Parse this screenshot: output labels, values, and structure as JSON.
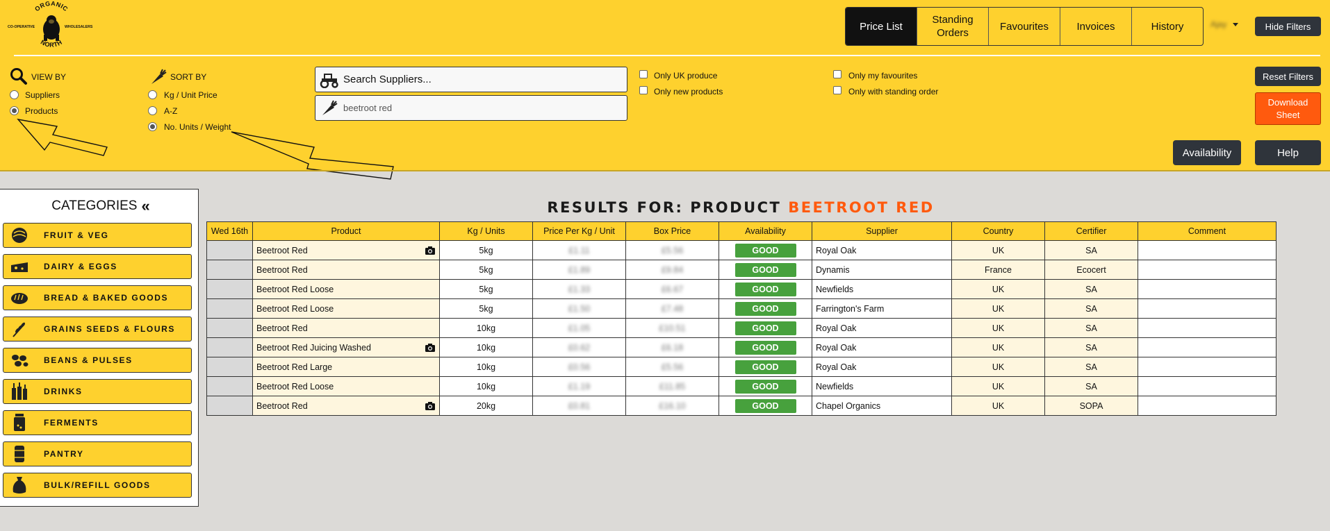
{
  "logo": {
    "top_text": "ORGANIC",
    "bottom_text": "NORTH",
    "left_text": "CO-OPERATIVE",
    "right_text": "WHOLESALERS"
  },
  "nav": {
    "tabs": [
      {
        "label": "Price List",
        "active": true
      },
      {
        "label": "Standing Orders"
      },
      {
        "label": "Favourites"
      },
      {
        "label": "Invoices"
      },
      {
        "label": "History"
      }
    ],
    "user_label": "Ajay",
    "hide_filters_label": "Hide Filters"
  },
  "filters": {
    "view_by_label": "VIEW BY",
    "view_by_options": [
      {
        "label": "Suppliers",
        "checked": false
      },
      {
        "label": "Products",
        "checked": true
      }
    ],
    "sort_by_label": "SORT BY",
    "sort_by_options": [
      {
        "label": "Kg / Unit Price",
        "checked": false
      },
      {
        "label": "A-Z",
        "checked": false
      },
      {
        "label": "No. Units / Weight",
        "checked": true
      }
    ],
    "search_suppliers_placeholder": "Search Suppliers...",
    "product_search_value": "beetroot red",
    "checkboxes": [
      {
        "label": "Only UK produce",
        "checked": false
      },
      {
        "label": "Only new products",
        "checked": false
      },
      {
        "label": "Only my favourites",
        "checked": false
      },
      {
        "label": "Only with standing order",
        "checked": false
      }
    ],
    "reset_label": "Reset Filters",
    "download_label": "Download Sheet",
    "availability_label": "Availability",
    "help_label": "Help"
  },
  "sidebar": {
    "title": "CATEGORIES",
    "items": [
      {
        "label": "FRUIT & VEG",
        "icon": "cabbage-icon"
      },
      {
        "label": "DAIRY & EGGS",
        "icon": "cheese-icon"
      },
      {
        "label": "BREAD & BAKED GOODS",
        "icon": "bread-icon"
      },
      {
        "label": "GRAINS SEEDS & FLOURS",
        "icon": "wheat-icon"
      },
      {
        "label": "BEANS & PULSES",
        "icon": "beans-icon"
      },
      {
        "label": "DRINKS",
        "icon": "bottles-icon"
      },
      {
        "label": "FERMENTS",
        "icon": "jar-icon"
      },
      {
        "label": "PANTRY",
        "icon": "can-icon"
      },
      {
        "label": "BULK/REFILL GOODS",
        "icon": "sack-icon"
      }
    ]
  },
  "results": {
    "prefix": "RESULTS FOR: PRODUCT",
    "query": "BEETROOT RED",
    "columns": [
      "Wed 16th",
      "Product",
      "Kg / Units",
      "Price Per Kg / Unit",
      "Box Price",
      "Availability",
      "Supplier",
      "Country",
      "Certifier",
      "Comment"
    ],
    "rows": [
      {
        "product": "Beetroot Red",
        "photo": true,
        "units": "5kg",
        "price_per": "£1.11",
        "box_price": "£5.56",
        "availability": "GOOD",
        "supplier": "Royal Oak",
        "country": "UK",
        "certifier": "SA",
        "comment": ""
      },
      {
        "product": "Beetroot Red",
        "photo": false,
        "units": "5kg",
        "price_per": "£1.89",
        "box_price": "£9.84",
        "availability": "GOOD",
        "supplier": "Dynamis",
        "country": "France",
        "certifier": "Ecocert",
        "comment": ""
      },
      {
        "product": "Beetroot Red Loose",
        "photo": false,
        "units": "5kg",
        "price_per": "£1.33",
        "box_price": "£6.67",
        "availability": "GOOD",
        "supplier": "Newfields",
        "country": "UK",
        "certifier": "SA",
        "comment": ""
      },
      {
        "product": "Beetroot Red Loose",
        "photo": false,
        "units": "5kg",
        "price_per": "£1.50",
        "box_price": "£7.48",
        "availability": "GOOD",
        "supplier": "Farrington's Farm",
        "country": "UK",
        "certifier": "SA",
        "comment": ""
      },
      {
        "product": "Beetroot Red",
        "photo": false,
        "units": "10kg",
        "price_per": "£1.05",
        "box_price": "£10.51",
        "availability": "GOOD",
        "supplier": "Royal Oak",
        "country": "UK",
        "certifier": "SA",
        "comment": ""
      },
      {
        "product": "Beetroot Red Juicing Washed",
        "photo": true,
        "units": "10kg",
        "price_per": "£0.62",
        "box_price": "£6.18",
        "availability": "GOOD",
        "supplier": "Royal Oak",
        "country": "UK",
        "certifier": "SA",
        "comment": ""
      },
      {
        "product": "Beetroot Red Large",
        "photo": false,
        "units": "10kg",
        "price_per": "£0.56",
        "box_price": "£5.56",
        "availability": "GOOD",
        "supplier": "Royal Oak",
        "country": "UK",
        "certifier": "SA",
        "comment": ""
      },
      {
        "product": "Beetroot Red Loose",
        "photo": false,
        "units": "10kg",
        "price_per": "£1.19",
        "box_price": "£11.85",
        "availability": "GOOD",
        "supplier": "Newfields",
        "country": "UK",
        "certifier": "SA",
        "comment": ""
      },
      {
        "product": "Beetroot Red",
        "photo": true,
        "units": "20kg",
        "price_per": "£0.81",
        "box_price": "£16.10",
        "availability": "GOOD",
        "supplier": "Chapel Organics",
        "country": "UK",
        "certifier": "SOPA",
        "comment": ""
      }
    ]
  },
  "colors": {
    "brand_yellow": "#fed12e",
    "accent_orange": "#ff5a0e",
    "good_green": "#47a13d",
    "dark_button": "#2f343b"
  }
}
